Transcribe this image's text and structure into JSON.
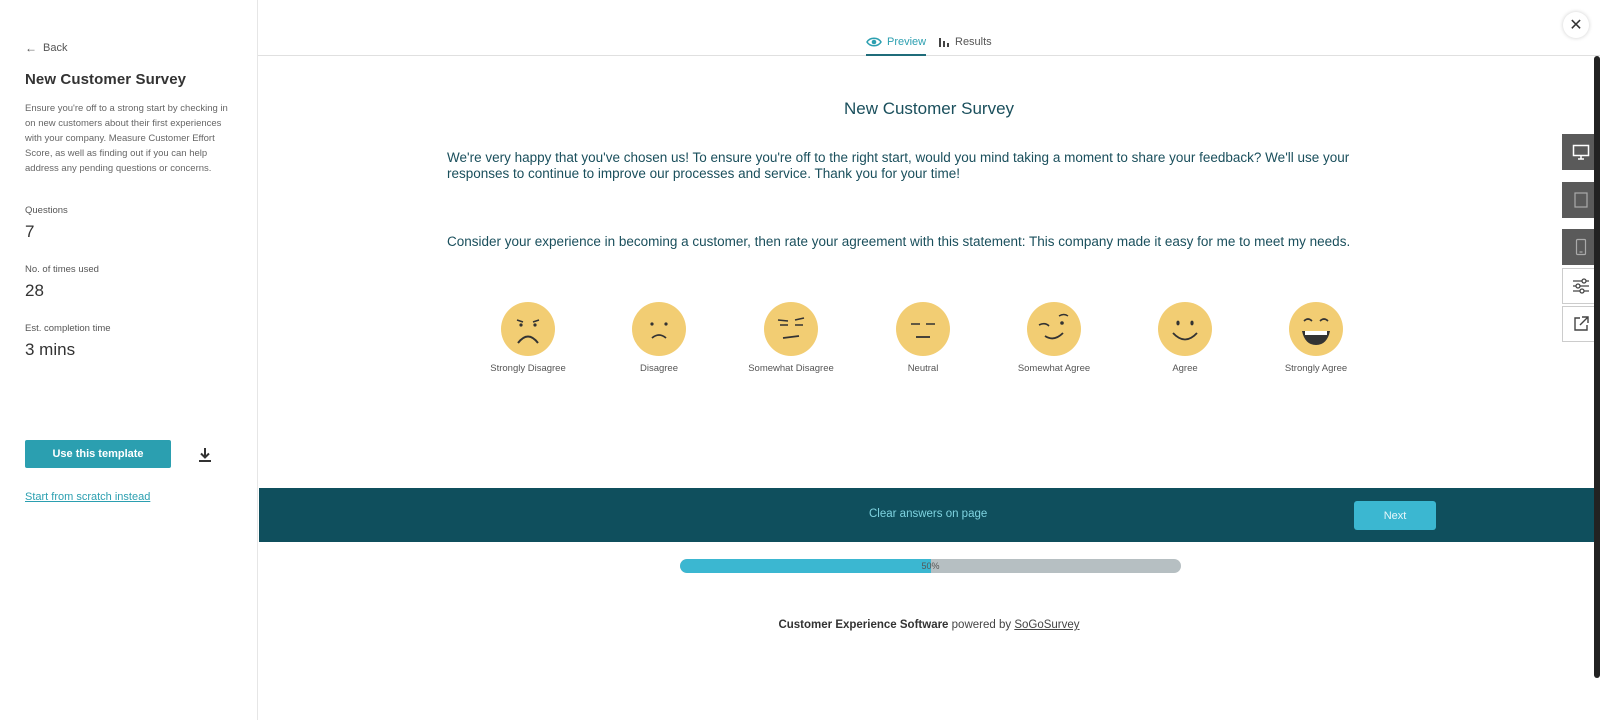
{
  "sidebar": {
    "back_label": "Back",
    "title": "New Customer Survey",
    "description": "Ensure you're off to a strong start by checking in on new customers about their first experiences with your company. Measure Customer Effort Score, as well as finding out if you can help address any pending questions or concerns.",
    "stats": [
      {
        "label": "Questions",
        "value": "7"
      },
      {
        "label": "No. of times used",
        "value": "28"
      },
      {
        "label": "Est. completion time",
        "value": "3 mins"
      }
    ],
    "use_template_label": "Use this template",
    "scratch_label": "Start from scratch instead"
  },
  "tabs": {
    "preview": "Preview",
    "results": "Results"
  },
  "survey": {
    "title": "New Customer Survey",
    "intro": "We're very happy that you've chosen us! To ensure you're off to the right start, would you mind taking a moment to share your feedback? We'll use your responses to continue to improve our processes and service. Thank you for your time!",
    "question": "Consider your experience in becoming a customer, then rate your agreement with this statement: This company made it easy for me to meet my needs.",
    "options": [
      {
        "label": "Strongly Disagree",
        "mood": "very-sad"
      },
      {
        "label": "Disagree",
        "mood": "sad"
      },
      {
        "label": "Somewhat Disagree",
        "mood": "skeptical"
      },
      {
        "label": "Neutral",
        "mood": "neutral"
      },
      {
        "label": "Somewhat Agree",
        "mood": "wink"
      },
      {
        "label": "Agree",
        "mood": "smile"
      },
      {
        "label": "Strongly Agree",
        "mood": "grin"
      }
    ],
    "face_color": "#f2cd73",
    "clear_label": "Clear answers on page",
    "next_label": "Next",
    "progress": {
      "percent": 50,
      "text": "50%"
    }
  },
  "footer": {
    "bold_text": "Customer Experience Software",
    "mid_text": " powered by ",
    "brand": "SoGoSurvey"
  },
  "colors": {
    "accent": "#2b9fb0",
    "footer_bar": "#0f4f5d",
    "title_text": "#1a4f5c"
  }
}
